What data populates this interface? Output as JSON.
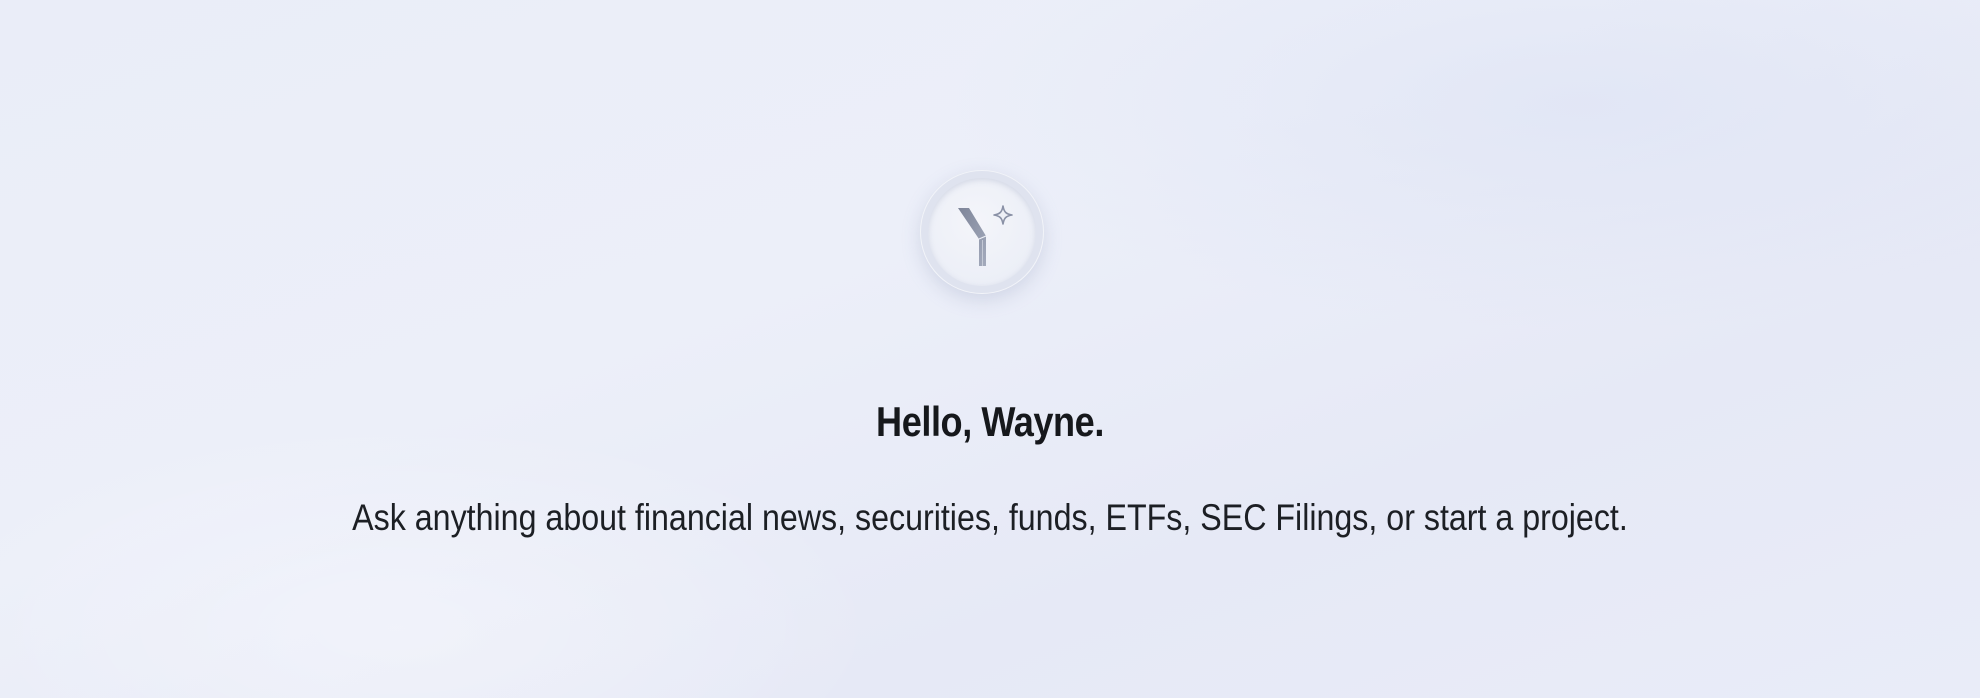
{
  "welcome": {
    "greeting": "Hello, Wayne.",
    "subtitle": "Ask anything about financial news, securities, funds, ETFs, SEC Filings, or start a project."
  },
  "logo": {
    "icon": "y-sparkle-logo-icon",
    "accent_color": "#8d95aa"
  },
  "colors": {
    "background": "#eaedf8",
    "text": "#16181c"
  }
}
